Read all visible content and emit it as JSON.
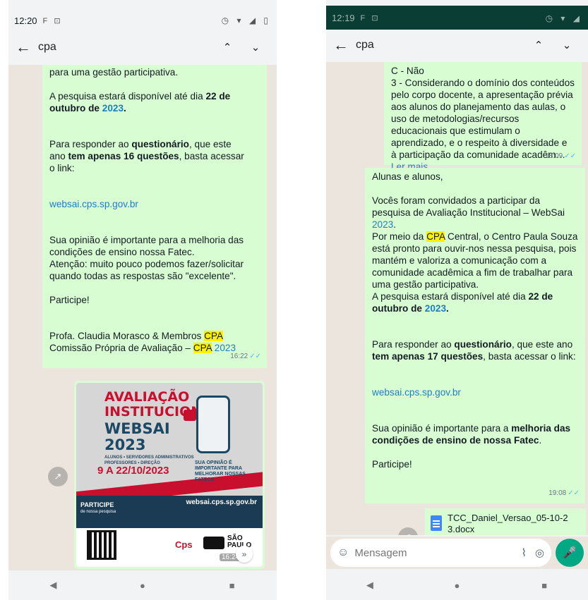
{
  "left": {
    "status": {
      "time": "12:20",
      "icons": "F ⊡",
      "right_icons": "◷ ▾ ◢ ▯"
    },
    "search": {
      "query": "cpa",
      "back": "←",
      "up": "⌃",
      "down": "⌄"
    },
    "message1": {
      "p1": "para uma gestão participativa.",
      "p2_pre": "A pesquisa estará disponível até dia ",
      "p2_bold1": "22 de",
      "p2_bold2": "outubro de ",
      "p2_year": "2023",
      "p2_post": ".",
      "p3_a": "Para responder ao ",
      "p3_b": "questionário",
      "p3_c": ", que este",
      "p3_d": "ano ",
      "p3_e": "tem apenas 16 questões",
      "p3_f": ", basta acessar",
      "p3_g": "o link:",
      "link": "websai.cps.sp.gov.br",
      "p4": "Sua opinião é importante para a melhoria das condições de ensino nossa Fatec.\nAtenção: muito pouco podemos fazer/solicitar quando todas as respostas são \"excelente\".",
      "p5": "Participe!",
      "sig1_pre": "Profa. Claudia Morasco & Membros ",
      "sig_hl": "CPA",
      "sig2_pre": "Comissão Própria de Avaliação – ",
      "sig2_hl": "CPA",
      "sig2_year": " 2023",
      "time": "16:22",
      "ticks": "✓✓"
    },
    "poster": {
      "line1": "AVALIAÇÃO",
      "line2": "INSTITUCIONAL",
      "line3": "WEBSAI",
      "line4": "2023",
      "audience": "ALUNOS • SERVIDORES ADMINISTRATIVOS PROFESSORES • DIREÇÃO",
      "dates": "9 A 22/10/2023",
      "opinion": "SUA OPINIÃO É IMPORTANTE PARA MELHORAR NOSSAS FATECS",
      "participe": "PARTICIPE",
      "participe_sub": "de nossa pesquisa",
      "url": "websai.cps.sp.gov.br",
      "cps": "Cps",
      "sp": "SÃO PAULO",
      "time": "16:24"
    },
    "forward_icon": "↗",
    "scroll_icon": "»",
    "nav": {
      "back": "◀",
      "home": "●",
      "recent": "■"
    }
  },
  "right": {
    "status": {
      "time": "12:19",
      "icons": "F ⊡",
      "right_icons": "◷ ▾ ◢"
    },
    "search": {
      "query": "cpa",
      "back": "←",
      "up": "⌃",
      "down": "⌄"
    },
    "message1": {
      "text": "C - Não\n3 - Considerando o domínio dos conteúdos pelo corpo docente, a apresentação prévia aos alunos do planejamento das aulas, o uso de metodologias/recursos educacionais que estimulam o aprendizado, e o respeito à diversidade e à participação da comunidade acadêm…",
      "more": "Ler mais",
      "time": "18:09",
      "ticks": "✓✓"
    },
    "message2": {
      "greeting": "Alunas e alunos,",
      "p1": "Vocês foram convidados a participar da pesquisa de Avaliação Institucional – WebSai ",
      "p1_year": "2023",
      "p1_end": ".",
      "p2_pre": "Por meio da ",
      "p2_hl": "CPA",
      "p2_post": " Central, o Centro Paula Souza está pronto para ouvir-nos nessa pesquisa, pois  mantém e valoriza a comunicação com a comunidade acadêmica a fim de trabalhar para uma gestão participativa.",
      "p3_pre": "A pesquisa estará disponível até dia ",
      "p3_bold": "22 de outubro de ",
      "p3_year": "2023",
      "p3_end": ".",
      "p4_a": "Para responder ao ",
      "p4_b": "questionário",
      "p4_c": ", que este ano ",
      "p4_d": "tem apenas 17 questões",
      "p4_e": ", basta acessar o link:",
      "link": "websai.cps.sp.gov.br",
      "p5_pre": "Sua opinião é importante para a ",
      "p5_bold": "melhoria das condições de ensino de nossa Fatec",
      "p5_end": ".",
      "p6": "Participe!",
      "time": "19:08",
      "ticks": "✓✓"
    },
    "doc": {
      "name": "TCC_Daniel_Versao_05-10-23.docx"
    },
    "composer": {
      "placeholder": "Mensagem",
      "emoji": "☺",
      "clip": "⌇",
      "camera": "◎",
      "mic": "🎤"
    },
    "forward_icon": "↗",
    "scroll_icon": "»",
    "nav": {
      "back": "◀",
      "home": "●",
      "recent": "■"
    }
  }
}
